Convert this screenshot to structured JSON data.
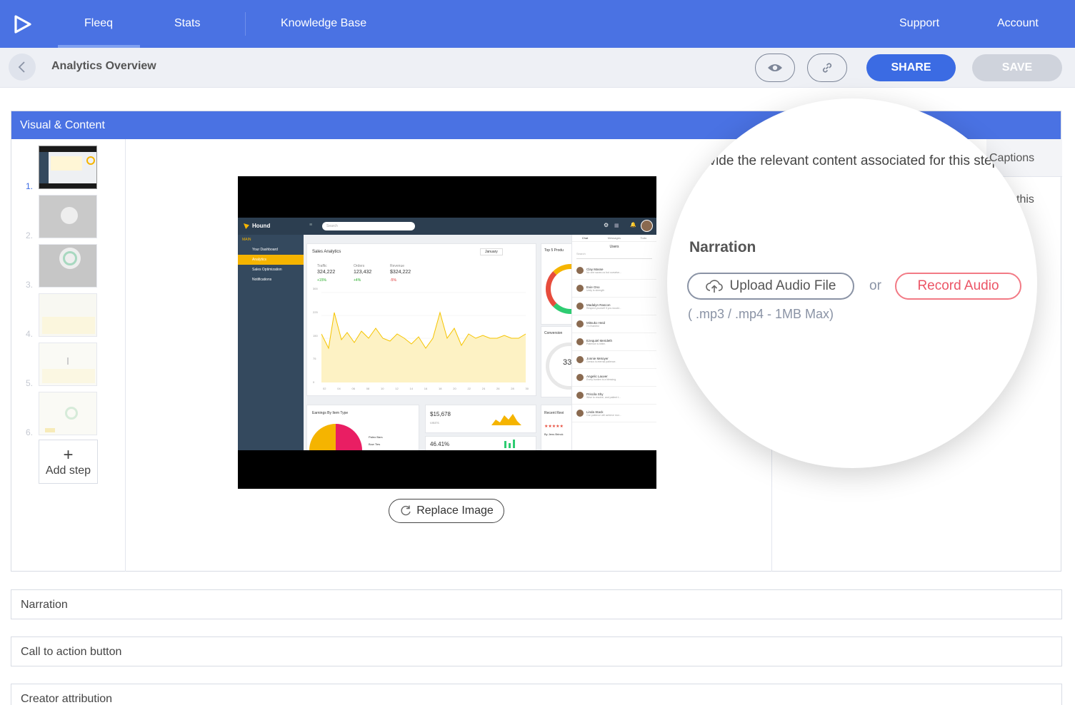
{
  "nav": {
    "items": [
      {
        "label": "Fleeq",
        "active": true
      },
      {
        "label": "Stats",
        "active": false
      },
      {
        "label": "Knowledge Base",
        "active": false
      }
    ],
    "support": "Support",
    "account": "Account",
    "accent_color": "#4a72e3"
  },
  "subheader": {
    "title": "Analytics Overview",
    "share_label": "SHARE",
    "save_label": "SAVE",
    "preview_icon": "eye-icon",
    "link_icon": "link-icon"
  },
  "panel": {
    "title": "Visual & Content",
    "steps": [
      {
        "num": "1.",
        "active": true
      },
      {
        "num": "2.",
        "active": false
      },
      {
        "num": "3.",
        "active": false
      },
      {
        "num": "4.",
        "active": false
      },
      {
        "num": "5.",
        "active": false
      },
      {
        "num": "6.",
        "active": false
      }
    ],
    "add_step_label": "Add step",
    "replace_image_label": "Replace Image"
  },
  "screenshot": {
    "brand": "Hound",
    "search_placeholder": "Search",
    "sidebar_section": "MAIN",
    "sidebar_items": [
      "Your Dashboard",
      "Analytics",
      "Sales Optimization",
      "Notifications"
    ],
    "sales_title": "Sales Analytics",
    "period": "January",
    "metrics": [
      {
        "label": "Traffic",
        "value": "324,222",
        "delta": "+15%"
      },
      {
        "label": "Orders",
        "value": "123,432",
        "delta": "+4%"
      },
      {
        "label": "Revenue",
        "value": "$324,222",
        "delta": "-5%"
      }
    ],
    "y_ticks": [
      "300",
      "225",
      "150",
      "75",
      "0"
    ],
    "x_ticks": [
      "02",
      "04",
      "06",
      "08",
      "10",
      "12",
      "14",
      "16",
      "18",
      "20",
      "22",
      "24",
      "26",
      "28",
      "30"
    ],
    "top_products": "Top 5 Produ",
    "conversion": "Conversion",
    "conversion_value": "33",
    "earnings_title": "Earnings By Item Type",
    "earnings_legend": [
      "Paleo Bars",
      "Bow Ties"
    ],
    "visits_value": "$15,678",
    "visits_label": "VISITS",
    "percent_value": "46.41%",
    "recent_reviews": "Recent Revi",
    "review_by": "By Jens Brinck",
    "chat_tabs": [
      "Chat",
      "Messages",
      "Todo"
    ],
    "users_title": "Users",
    "users": [
      {
        "name": "Clay Masse",
        "msg": "No one saves us but ourselve..."
      },
      {
        "name": "Evie Ono",
        "msg": "Unity is strength"
      },
      {
        "name": "Madalyn Rascon",
        "msg": "Respect yourself if you would..."
      },
      {
        "name": "Mitsuko Heid",
        "msg": "I'm thankful"
      },
      {
        "name": "Ezequiel Merideth",
        "msg": "Patience is bitter."
      },
      {
        "name": "Jonnie Metoyer",
        "msg": "Genius is eternal patience."
      },
      {
        "name": "Angelic Lauver",
        "msg": "Every burden is a blessing."
      },
      {
        "name": "Priscila Shy",
        "msg": "Wise to resolve, and patient t..."
      },
      {
        "name": "Linda Stack",
        "msg": "Our patience will achieve mor..."
      }
    ]
  },
  "right": {
    "captions_tab": "Captions",
    "content_text_fragment": "this"
  },
  "magnifier": {
    "content_text": "ovide the relevant content associated for this step",
    "narration_title": "Narration",
    "upload_label": "Upload Audio File",
    "or_label": "or",
    "record_label": "Record Audio",
    "hint": "( .mp3 / .mp4 - 1MB Max)",
    "record_color": "#ec5566"
  },
  "sections": {
    "narration": "Narration",
    "cta": "Call to action button",
    "attribution": "Creator attribution"
  }
}
